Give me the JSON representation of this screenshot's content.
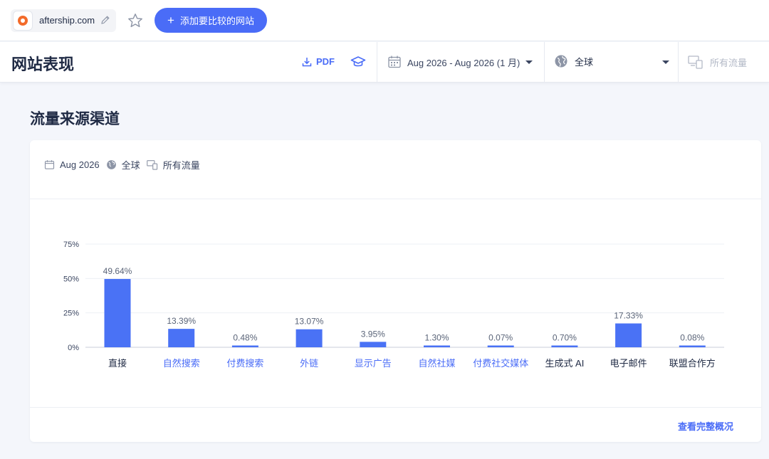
{
  "topbar": {
    "domain": "aftership.com",
    "add_button_label": "添加要比较的网站"
  },
  "header": {
    "title": "网站表现",
    "pdf_label": "PDF",
    "date_range": "Aug 2026 - Aug 2026 (1 月)",
    "region": "全球",
    "traffic": "所有流量"
  },
  "section": {
    "title": "流量来源渠道",
    "filter_date": "Aug 2026",
    "filter_region": "全球",
    "filter_traffic": "所有流量",
    "view_link": "查看完整概况"
  },
  "colors": {
    "accent": "#4a6cf7",
    "bar": "#4a72f5",
    "link_category": "#4a6cf7",
    "plain_category": "#1f2a44"
  },
  "chart_data": {
    "type": "bar",
    "categories": [
      "直接",
      "自然搜索",
      "付费搜索",
      "外链",
      "显示广告",
      "自然社媒",
      "付费社交媒体",
      "生成式 AI",
      "电子邮件",
      "联盟合作方"
    ],
    "category_display": [
      "直接",
      "自然搜索",
      "付费搜索",
      "外链",
      "显示广告",
      "自然社媒",
      "付费社交媒体",
      "生成式 AI",
      "电子邮件",
      "联盟合作方"
    ],
    "category_link": [
      false,
      true,
      true,
      true,
      true,
      true,
      true,
      false,
      false,
      false
    ],
    "values": [
      49.64,
      13.39,
      0.48,
      13.07,
      3.95,
      1.3,
      0.07,
      0.7,
      17.33,
      0.08
    ],
    "value_labels": [
      "49.64%",
      "13.39%",
      "0.48%",
      "13.07%",
      "3.95%",
      "1.30%",
      "0.07%",
      "0.70%",
      "17.33%",
      "0.08%"
    ],
    "yticks": [
      0,
      25,
      50,
      75
    ],
    "ytick_labels": [
      "0%",
      "25%",
      "50%",
      "75%"
    ],
    "ylim": [
      0,
      75
    ],
    "grid": true,
    "title": "",
    "xlabel": "",
    "ylabel": ""
  }
}
